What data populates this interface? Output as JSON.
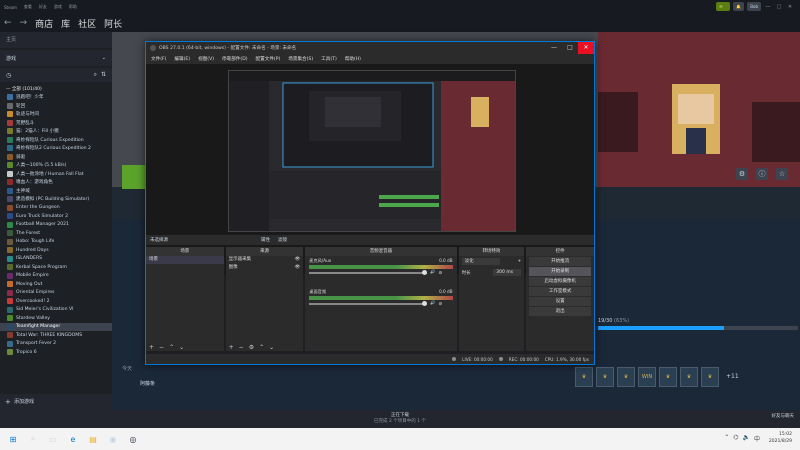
{
  "steam_top": {
    "menu": [
      "Steam",
      "查看",
      "好友",
      "游戏",
      "帮助"
    ],
    "user": "Bob",
    "controls": [
      "—",
      "□",
      "✕"
    ]
  },
  "nav": {
    "back": "←",
    "forward": "→",
    "items": [
      "商店",
      "库",
      "社区",
      "阿长"
    ]
  },
  "sidebar": {
    "home": "主页",
    "filter_label": "游戏",
    "section": "— 全部 (101/40)",
    "games": [
      {
        "name": "逃跑吧！少年",
        "color": "#3a6ea5"
      },
      {
        "name": "轮回",
        "color": "#6a6a6a"
      },
      {
        "name": "轨迹与时间",
        "color": "#c98a2b"
      },
      {
        "name": "荒野乱斗",
        "color": "#a53a3a"
      },
      {
        "name": "猫：2猫人：Fill 小猪",
        "color": "#7a7a2b"
      },
      {
        "name": "奇妙探险队 Curious Expedition",
        "color": "#2b7a5a"
      },
      {
        "name": "奇妙探险队2 Curious Expedition 2",
        "color": "#2b6a8a"
      },
      {
        "name": "骑驱",
        "color": "#8a5a2b"
      },
      {
        "name": "人类一100% (5.5 kB/s)",
        "color": "#5a8a2b"
      },
      {
        "name": "人类一败涂地 / Human Fall Flat",
        "color": "#c8c8c8"
      },
      {
        "name": "嗜血人：游戏角色",
        "color": "#8a2b2b"
      },
      {
        "name": "主神域",
        "color": "#2b5a8a"
      },
      {
        "name": "建造模拟 (PC Building Simulator)",
        "color": "#4a4a6a"
      },
      {
        "name": "Enter the Gungeon",
        "color": "#8a4a2b"
      },
      {
        "name": "Euro Truck Simulator 2",
        "color": "#2b4a8a"
      },
      {
        "name": "Football Manager 2021",
        "color": "#2b8a4a"
      },
      {
        "name": "The Forest",
        "color": "#3a5a3a"
      },
      {
        "name": "Hobo: Tough Life",
        "color": "#6a5a3a"
      },
      {
        "name": "Hundred Days",
        "color": "#8a6a2b"
      },
      {
        "name": "ISLANDERS",
        "color": "#2b8a8a"
      },
      {
        "name": "Kerbal Space Program",
        "color": "#5a6a2b"
      },
      {
        "name": "Mobile Empire",
        "color": "#6a2b6a"
      },
      {
        "name": "Moving Out",
        "color": "#c86a2b"
      },
      {
        "name": "Oriental Empires",
        "color": "#8a2b4a"
      },
      {
        "name": "Overcooked! 2",
        "color": "#c83a3a"
      },
      {
        "name": "Sid Meier's Civilization VI",
        "color": "#2b6a6a"
      },
      {
        "name": "Stardew Valley",
        "color": "#4a8a2b"
      },
      {
        "name": "Teamfight Manager",
        "color": "#2b4a6a"
      },
      {
        "name": "Total War: THREE KINGDOMS",
        "color": "#8a3a2b"
      },
      {
        "name": "Transport Fever 2",
        "color": "#3a6a8a"
      },
      {
        "name": "Tropico 6",
        "color": "#6a8a3a"
      }
    ],
    "selected_index": 27,
    "add_game": "添加游戏"
  },
  "main": {
    "today": "今天",
    "activity_user": "阿藤条",
    "achievement_count": "19/30",
    "achievement_percent": "(63%)",
    "achievement_progress": 0.63,
    "more_achievements": "+11",
    "achievements": [
      "♛",
      "♛",
      "♛",
      "WIN",
      "♛",
      "♛",
      "♛"
    ]
  },
  "bottom": {
    "download_title": "正在下载",
    "download_sub": "已完成 2 个项目中的 1 个",
    "friends": "好友与聊天"
  },
  "obs": {
    "title": "OBS 27.0.1 (64-bit, windows) - 配置文件: 未命名 - 场景: 未命名",
    "menu": [
      "文件(F)",
      "编辑(E)",
      "视图(V)",
      "停靠部件(D)",
      "配置文件(P)",
      "场景集合(S)",
      "工具(T)",
      "帮助(H)"
    ],
    "scene_bar": {
      "left": "未选择源",
      "properties": "属性",
      "filters": "滤镜"
    },
    "docks": {
      "scenes": {
        "title": "场景",
        "items": [
          "场景"
        ]
      },
      "sources": {
        "title": "来源",
        "items": [
          "显示器采集",
          "图像"
        ]
      },
      "mixer": {
        "title": "音频混音器",
        "items": [
          {
            "name": "麦克风/Aux",
            "db": "0.0 dB"
          },
          {
            "name": "桌面音频",
            "db": "0.0 dB"
          }
        ]
      },
      "transitions": {
        "title": "转场特效",
        "type": "淡化",
        "duration_label": "时长",
        "duration": "300 ms"
      },
      "controls": {
        "title": "控件",
        "buttons": [
          "开始推流",
          "开始录制",
          "启动虚拟摄像机",
          "工作室模式",
          "设置",
          "退出"
        ],
        "active_index": 1
      }
    },
    "status": {
      "live": "LIVE: 00:00:00",
      "rec": "REC: 00:00:00",
      "cpu": "CPU: 1.9%, 30.00 fps"
    }
  },
  "taskbar": {
    "time": "15:02",
    "date": "2021/8/29"
  }
}
